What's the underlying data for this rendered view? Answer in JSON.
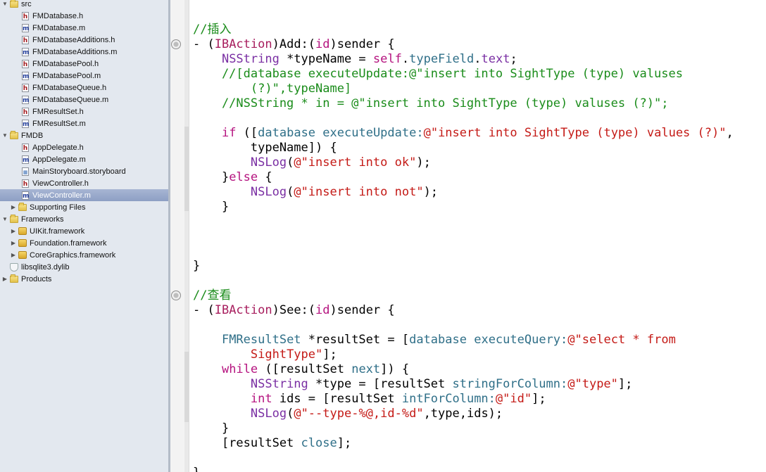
{
  "navigator": {
    "items": [
      {
        "label": "src",
        "type": "folder",
        "indent": 0,
        "expanded": true
      },
      {
        "label": "FMDatabase.h",
        "type": "h",
        "indent": 1
      },
      {
        "label": "FMDatabase.m",
        "type": "m",
        "indent": 1
      },
      {
        "label": "FMDatabaseAdditions.h",
        "type": "h",
        "indent": 1
      },
      {
        "label": "FMDatabaseAdditions.m",
        "type": "m",
        "indent": 1
      },
      {
        "label": "FMDatabasePool.h",
        "type": "h",
        "indent": 1
      },
      {
        "label": "FMDatabasePool.m",
        "type": "m",
        "indent": 1
      },
      {
        "label": "FMDatabaseQueue.h",
        "type": "h",
        "indent": 1
      },
      {
        "label": "FMDatabaseQueue.m",
        "type": "m",
        "indent": 1
      },
      {
        "label": "FMResultSet.h",
        "type": "h",
        "indent": 1
      },
      {
        "label": "FMResultSet.m",
        "type": "m",
        "indent": 1
      },
      {
        "label": "FMDB",
        "type": "folder",
        "indent": 0,
        "expanded": true
      },
      {
        "label": "AppDelegate.h",
        "type": "h",
        "indent": 1
      },
      {
        "label": "AppDelegate.m",
        "type": "m",
        "indent": 1
      },
      {
        "label": "MainStoryboard.storyboard",
        "type": "sb",
        "indent": 1
      },
      {
        "label": "ViewController.h",
        "type": "h",
        "indent": 1
      },
      {
        "label": "ViewController.m",
        "type": "m",
        "indent": 1,
        "selected": true
      },
      {
        "label": "Supporting Files",
        "type": "folder",
        "indent": 1,
        "expanded": false
      },
      {
        "label": "Frameworks",
        "type": "folder",
        "indent": 0,
        "expanded": true
      },
      {
        "label": "UIKit.framework",
        "type": "framework",
        "indent": 1,
        "expanded": false
      },
      {
        "label": "Foundation.framework",
        "type": "framework",
        "indent": 1,
        "expanded": false
      },
      {
        "label": "CoreGraphics.framework",
        "type": "framework",
        "indent": 1,
        "expanded": false
      },
      {
        "label": "libsqlite3.dylib",
        "type": "dylib",
        "indent": 0
      },
      {
        "label": "Products",
        "type": "folder",
        "indent": 0,
        "expanded": false
      }
    ]
  },
  "editor": {
    "lines": [
      {
        "tokens": [
          {
            "t": "//插入",
            "c": "cmt"
          }
        ]
      },
      {
        "tokens": [
          {
            "t": "- ("
          },
          {
            "t": "IBAction",
            "c": "kw"
          },
          {
            "t": ")Add:("
          },
          {
            "t": "id",
            "c": "kw2"
          },
          {
            "t": ")sender {"
          }
        ]
      },
      {
        "tokens": [
          {
            "t": "    "
          },
          {
            "t": "NSString",
            "c": "cls"
          },
          {
            "t": " *typeName = "
          },
          {
            "t": "self",
            "c": "kw2"
          },
          {
            "t": "."
          },
          {
            "t": "typeField",
            "c": "meth"
          },
          {
            "t": "."
          },
          {
            "t": "text",
            "c": "cls"
          },
          {
            "t": ";"
          }
        ]
      },
      {
        "tokens": [
          {
            "t": "    //[database executeUpdate:@\"insert into SightType (type) valuses",
            "c": "cmt"
          }
        ]
      },
      {
        "tokens": [
          {
            "t": "        (?)\",typeName]",
            "c": "cmt"
          }
        ]
      },
      {
        "tokens": [
          {
            "t": "    //NSString * in = @\"insert into SightType (type) valuses (?)\";",
            "c": "cmt"
          }
        ]
      },
      {
        "tokens": [
          {
            "t": ""
          }
        ]
      },
      {
        "tokens": [
          {
            "t": "    "
          },
          {
            "t": "if",
            "c": "kw2"
          },
          {
            "t": " (["
          },
          {
            "t": "database",
            "c": "meth"
          },
          {
            "t": " "
          },
          {
            "t": "executeUpdate:",
            "c": "meth"
          },
          {
            "t": "@\"insert into SightType (type) values (?)\"",
            "c": "str"
          },
          {
            "t": ","
          }
        ]
      },
      {
        "tokens": [
          {
            "t": "        typeName]) {"
          }
        ]
      },
      {
        "tokens": [
          {
            "t": "        "
          },
          {
            "t": "NSLog",
            "c": "cls"
          },
          {
            "t": "("
          },
          {
            "t": "@\"insert into ok\"",
            "c": "str"
          },
          {
            "t": ");"
          }
        ]
      },
      {
        "tokens": [
          {
            "t": "    }"
          },
          {
            "t": "else",
            "c": "kw2"
          },
          {
            "t": " {"
          }
        ]
      },
      {
        "tokens": [
          {
            "t": "        "
          },
          {
            "t": "NSLog",
            "c": "cls"
          },
          {
            "t": "("
          },
          {
            "t": "@\"insert into not\"",
            "c": "str"
          },
          {
            "t": ");"
          }
        ]
      },
      {
        "tokens": [
          {
            "t": "    }"
          }
        ]
      },
      {
        "tokens": [
          {
            "t": ""
          }
        ]
      },
      {
        "tokens": [
          {
            "t": ""
          }
        ]
      },
      {
        "tokens": [
          {
            "t": ""
          }
        ]
      },
      {
        "tokens": [
          {
            "t": "}"
          }
        ]
      },
      {
        "tokens": [
          {
            "t": ""
          }
        ]
      },
      {
        "tokens": [
          {
            "t": "//查看",
            "c": "cmt"
          }
        ]
      },
      {
        "tokens": [
          {
            "t": "- ("
          },
          {
            "t": "IBAction",
            "c": "kw"
          },
          {
            "t": ")See:("
          },
          {
            "t": "id",
            "c": "kw2"
          },
          {
            "t": ")sender {"
          }
        ]
      },
      {
        "tokens": [
          {
            "t": ""
          }
        ]
      },
      {
        "tokens": [
          {
            "t": "    "
          },
          {
            "t": "FMResultSet",
            "c": "meth"
          },
          {
            "t": " *resultSet = ["
          },
          {
            "t": "database",
            "c": "meth"
          },
          {
            "t": " "
          },
          {
            "t": "executeQuery:",
            "c": "meth"
          },
          {
            "t": "@\"select * from",
            "c": "str"
          }
        ]
      },
      {
        "tokens": [
          {
            "t": "        "
          },
          {
            "t": "SightType\"",
            "c": "str"
          },
          {
            "t": "];"
          }
        ]
      },
      {
        "tokens": [
          {
            "t": "    "
          },
          {
            "t": "while",
            "c": "kw2"
          },
          {
            "t": " ([resultSet "
          },
          {
            "t": "next",
            "c": "meth"
          },
          {
            "t": "]) {"
          }
        ]
      },
      {
        "tokens": [
          {
            "t": "        "
          },
          {
            "t": "NSString",
            "c": "cls"
          },
          {
            "t": " *type = [resultSet "
          },
          {
            "t": "stringForColumn:",
            "c": "meth"
          },
          {
            "t": "@\"type\"",
            "c": "str"
          },
          {
            "t": "];"
          }
        ]
      },
      {
        "tokens": [
          {
            "t": "        "
          },
          {
            "t": "int",
            "c": "kw2"
          },
          {
            "t": " ids = [resultSet "
          },
          {
            "t": "intForColumn:",
            "c": "meth"
          },
          {
            "t": "@\"id\"",
            "c": "str"
          },
          {
            "t": "];"
          }
        ]
      },
      {
        "tokens": [
          {
            "t": "        "
          },
          {
            "t": "NSLog",
            "c": "cls"
          },
          {
            "t": "("
          },
          {
            "t": "@\"--type-%@,id-%d\"",
            "c": "str"
          },
          {
            "t": ",type,ids);"
          }
        ]
      },
      {
        "tokens": [
          {
            "t": "    }"
          }
        ]
      },
      {
        "tokens": [
          {
            "t": "    [resultSet "
          },
          {
            "t": "close",
            "c": "meth"
          },
          {
            "t": "];"
          }
        ]
      },
      {
        "tokens": [
          {
            "t": ""
          }
        ]
      },
      {
        "tokens": [
          {
            "t": "}"
          }
        ]
      }
    ]
  }
}
